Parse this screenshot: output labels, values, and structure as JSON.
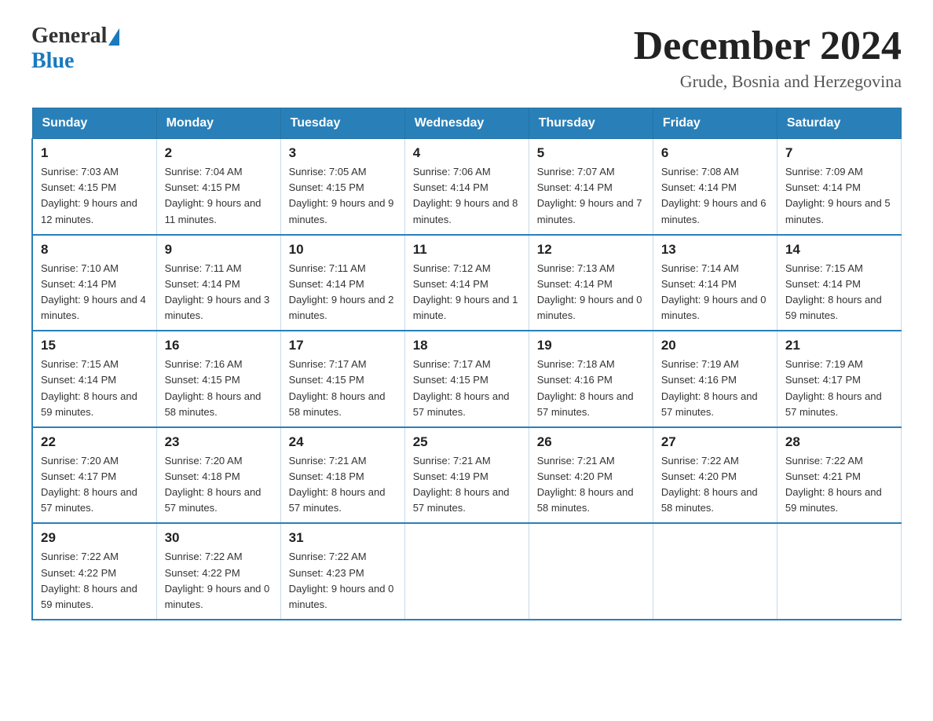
{
  "header": {
    "logo_general": "General",
    "logo_blue": "Blue",
    "month_title": "December 2024",
    "location": "Grude, Bosnia and Herzegovina"
  },
  "days_of_week": [
    "Sunday",
    "Monday",
    "Tuesday",
    "Wednesday",
    "Thursday",
    "Friday",
    "Saturday"
  ],
  "weeks": [
    [
      {
        "day": "1",
        "sunrise": "7:03 AM",
        "sunset": "4:15 PM",
        "daylight": "9 hours and 12 minutes."
      },
      {
        "day": "2",
        "sunrise": "7:04 AM",
        "sunset": "4:15 PM",
        "daylight": "9 hours and 11 minutes."
      },
      {
        "day": "3",
        "sunrise": "7:05 AM",
        "sunset": "4:15 PM",
        "daylight": "9 hours and 9 minutes."
      },
      {
        "day": "4",
        "sunrise": "7:06 AM",
        "sunset": "4:14 PM",
        "daylight": "9 hours and 8 minutes."
      },
      {
        "day": "5",
        "sunrise": "7:07 AM",
        "sunset": "4:14 PM",
        "daylight": "9 hours and 7 minutes."
      },
      {
        "day": "6",
        "sunrise": "7:08 AM",
        "sunset": "4:14 PM",
        "daylight": "9 hours and 6 minutes."
      },
      {
        "day": "7",
        "sunrise": "7:09 AM",
        "sunset": "4:14 PM",
        "daylight": "9 hours and 5 minutes."
      }
    ],
    [
      {
        "day": "8",
        "sunrise": "7:10 AM",
        "sunset": "4:14 PM",
        "daylight": "9 hours and 4 minutes."
      },
      {
        "day": "9",
        "sunrise": "7:11 AM",
        "sunset": "4:14 PM",
        "daylight": "9 hours and 3 minutes."
      },
      {
        "day": "10",
        "sunrise": "7:11 AM",
        "sunset": "4:14 PM",
        "daylight": "9 hours and 2 minutes."
      },
      {
        "day": "11",
        "sunrise": "7:12 AM",
        "sunset": "4:14 PM",
        "daylight": "9 hours and 1 minute."
      },
      {
        "day": "12",
        "sunrise": "7:13 AM",
        "sunset": "4:14 PM",
        "daylight": "9 hours and 0 minutes."
      },
      {
        "day": "13",
        "sunrise": "7:14 AM",
        "sunset": "4:14 PM",
        "daylight": "9 hours and 0 minutes."
      },
      {
        "day": "14",
        "sunrise": "7:15 AM",
        "sunset": "4:14 PM",
        "daylight": "8 hours and 59 minutes."
      }
    ],
    [
      {
        "day": "15",
        "sunrise": "7:15 AM",
        "sunset": "4:14 PM",
        "daylight": "8 hours and 59 minutes."
      },
      {
        "day": "16",
        "sunrise": "7:16 AM",
        "sunset": "4:15 PM",
        "daylight": "8 hours and 58 minutes."
      },
      {
        "day": "17",
        "sunrise": "7:17 AM",
        "sunset": "4:15 PM",
        "daylight": "8 hours and 58 minutes."
      },
      {
        "day": "18",
        "sunrise": "7:17 AM",
        "sunset": "4:15 PM",
        "daylight": "8 hours and 57 minutes."
      },
      {
        "day": "19",
        "sunrise": "7:18 AM",
        "sunset": "4:16 PM",
        "daylight": "8 hours and 57 minutes."
      },
      {
        "day": "20",
        "sunrise": "7:19 AM",
        "sunset": "4:16 PM",
        "daylight": "8 hours and 57 minutes."
      },
      {
        "day": "21",
        "sunrise": "7:19 AM",
        "sunset": "4:17 PM",
        "daylight": "8 hours and 57 minutes."
      }
    ],
    [
      {
        "day": "22",
        "sunrise": "7:20 AM",
        "sunset": "4:17 PM",
        "daylight": "8 hours and 57 minutes."
      },
      {
        "day": "23",
        "sunrise": "7:20 AM",
        "sunset": "4:18 PM",
        "daylight": "8 hours and 57 minutes."
      },
      {
        "day": "24",
        "sunrise": "7:21 AM",
        "sunset": "4:18 PM",
        "daylight": "8 hours and 57 minutes."
      },
      {
        "day": "25",
        "sunrise": "7:21 AM",
        "sunset": "4:19 PM",
        "daylight": "8 hours and 57 minutes."
      },
      {
        "day": "26",
        "sunrise": "7:21 AM",
        "sunset": "4:20 PM",
        "daylight": "8 hours and 58 minutes."
      },
      {
        "day": "27",
        "sunrise": "7:22 AM",
        "sunset": "4:20 PM",
        "daylight": "8 hours and 58 minutes."
      },
      {
        "day": "28",
        "sunrise": "7:22 AM",
        "sunset": "4:21 PM",
        "daylight": "8 hours and 59 minutes."
      }
    ],
    [
      {
        "day": "29",
        "sunrise": "7:22 AM",
        "sunset": "4:22 PM",
        "daylight": "8 hours and 59 minutes."
      },
      {
        "day": "30",
        "sunrise": "7:22 AM",
        "sunset": "4:22 PM",
        "daylight": "9 hours and 0 minutes."
      },
      {
        "day": "31",
        "sunrise": "7:22 AM",
        "sunset": "4:23 PM",
        "daylight": "9 hours and 0 minutes."
      },
      null,
      null,
      null,
      null
    ]
  ],
  "labels": {
    "sunrise": "Sunrise:",
    "sunset": "Sunset:",
    "daylight": "Daylight:"
  }
}
